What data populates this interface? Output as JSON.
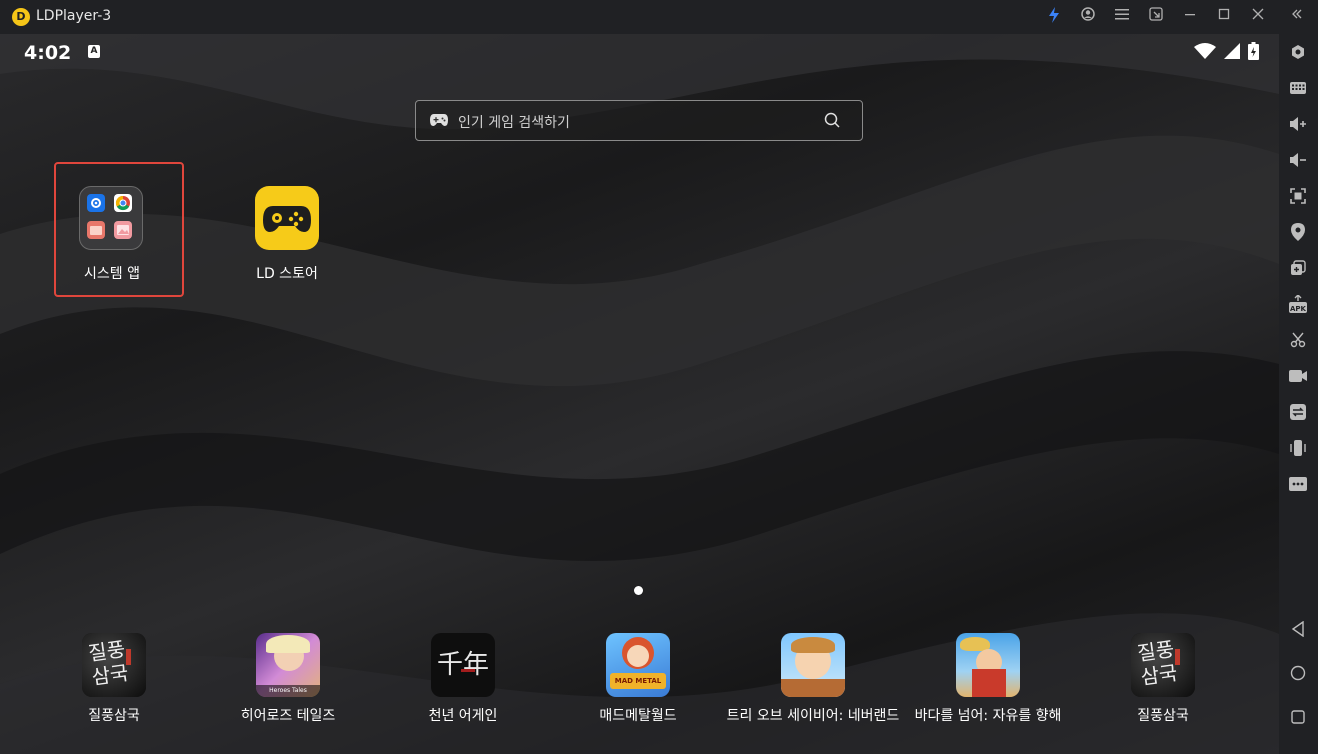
{
  "window": {
    "title": "LDPlayer-3",
    "logo_letter": "D"
  },
  "statusbar": {
    "time": "4:02",
    "notification_letter": "A"
  },
  "search": {
    "placeholder": "인기 게임 검색하기"
  },
  "home_apps": [
    {
      "label": "시스템 앱"
    },
    {
      "label": "LD 스토어"
    }
  ],
  "dock_apps": [
    {
      "label": "질풍삼국",
      "icon_text": "질풍\n삼국"
    },
    {
      "label": "히어로즈 테일즈",
      "icon_text": "Heroes Tales"
    },
    {
      "label": "천년 어게인",
      "icon_text": "千年"
    },
    {
      "label": "매드메탈월드",
      "icon_text": "MAD METAL"
    },
    {
      "label": "트리 오브 세이비어: 네버랜드",
      "icon_text": ""
    },
    {
      "label": "바다를 넘어: 자유를 향해",
      "icon_text": ""
    },
    {
      "label": "질풍삼국",
      "icon_text": "질풍\n삼국"
    }
  ],
  "colors": {
    "accent": "#f6cb19",
    "highlight_border": "#e0463c",
    "sidebar_bg": "#202124"
  }
}
